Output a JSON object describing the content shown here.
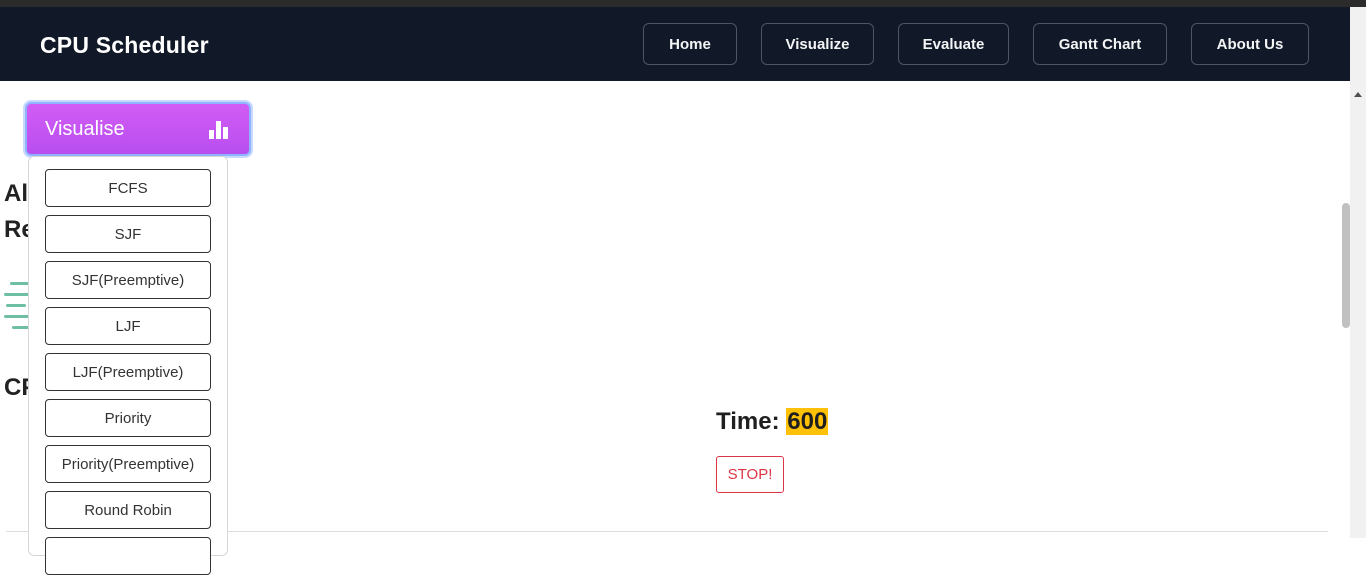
{
  "app": {
    "title": "CPU Scheduler"
  },
  "nav": {
    "items": [
      {
        "label": "Home"
      },
      {
        "label": "Visualize"
      },
      {
        "label": "Evaluate"
      },
      {
        "label": "Gantt Chart"
      },
      {
        "label": "About Us"
      }
    ]
  },
  "visualise_menu": {
    "label": "Visualise",
    "icon": "bar-chart-icon",
    "options": [
      {
        "label": "FCFS"
      },
      {
        "label": "SJF"
      },
      {
        "label": "SJF(Preemptive)"
      },
      {
        "label": "LJF"
      },
      {
        "label": "LJF(Preemptive)"
      },
      {
        "label": "Priority"
      },
      {
        "label": "Priority(Preemptive)"
      },
      {
        "label": "Round Robin"
      }
    ]
  },
  "background_text": {
    "line1": "Al",
    "line2": "Re",
    "line3": "CP"
  },
  "simulation": {
    "time_label": "Time:",
    "time_value": "600",
    "stop_label": "STOP!"
  },
  "colors": {
    "navbar": "#111827",
    "visualise_button": "#c456f2",
    "time_highlight": "#ffc107",
    "stop_button": "#dc3545",
    "accent_lines": "#6fbfa4"
  }
}
